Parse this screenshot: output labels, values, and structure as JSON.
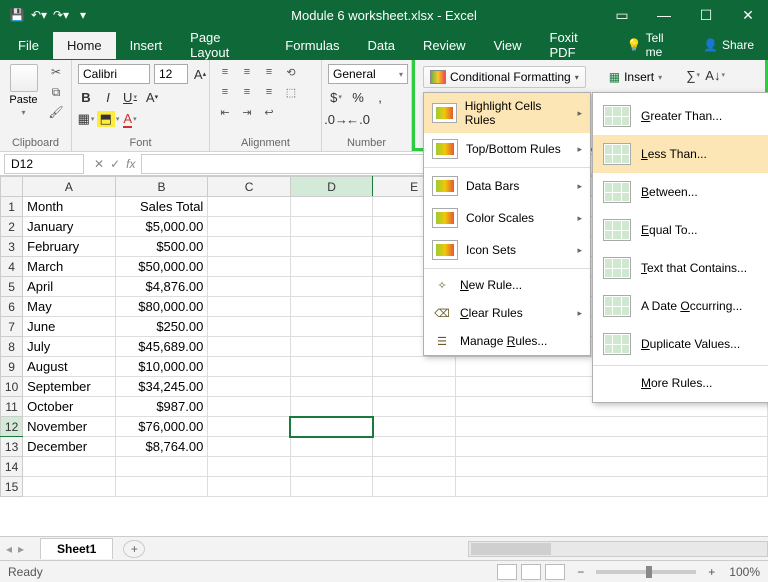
{
  "title": "Module 6 worksheet.xlsx  -  Excel",
  "qat": [
    "save-icon",
    "undo-icon",
    "redo-icon"
  ],
  "window_buttons": {
    "ribbon_opts": "▭",
    "min": "—",
    "max": "☐",
    "close": "✕"
  },
  "tabs": {
    "file": "File",
    "home": "Home",
    "insert": "Insert",
    "page_layout": "Page Layout",
    "formulas": "Formulas",
    "data": "Data",
    "review": "Review",
    "view": "View",
    "foxit": "Foxit PDF",
    "tellme": "Tell me",
    "share": "Share"
  },
  "ribbon": {
    "clipboard": {
      "paste": "Paste",
      "label": "Clipboard"
    },
    "font": {
      "name": "Calibri",
      "size": "12",
      "label": "Font"
    },
    "alignment": {
      "label": "Alignment"
    },
    "number": {
      "format": "General",
      "label": "Number"
    },
    "cf_label": "Conditional Formatting",
    "insert_label": "Insert"
  },
  "namebox": "D12",
  "columns": [
    "A",
    "B",
    "C",
    "D",
    "E"
  ],
  "rows": [
    {
      "n": "1",
      "a": "Month",
      "b": "Sales Total"
    },
    {
      "n": "2",
      "a": "January",
      "b": "$5,000.00"
    },
    {
      "n": "3",
      "a": "February",
      "b": "$500.00"
    },
    {
      "n": "4",
      "a": "March",
      "b": "$50,000.00"
    },
    {
      "n": "5",
      "a": "April",
      "b": "$4,876.00"
    },
    {
      "n": "6",
      "a": "May",
      "b": "$80,000.00"
    },
    {
      "n": "7",
      "a": "June",
      "b": "$250.00"
    },
    {
      "n": "8",
      "a": "July",
      "b": "$45,689.00"
    },
    {
      "n": "9",
      "a": "August",
      "b": "$10,000.00"
    },
    {
      "n": "10",
      "a": "September",
      "b": "$34,245.00"
    },
    {
      "n": "11",
      "a": "October",
      "b": "$987.00"
    },
    {
      "n": "12",
      "a": "November",
      "b": "$76,000.00"
    },
    {
      "n": "13",
      "a": "December",
      "b": "$8,764.00"
    },
    {
      "n": "14",
      "a": "",
      "b": ""
    },
    {
      "n": "15",
      "a": "",
      "b": ""
    }
  ],
  "cf_menu": {
    "highlight": "Highlight Cells Rules",
    "topbottom": "Top/Bottom Rules",
    "databars": "Data Bars",
    "colorscales": "Color Scales",
    "iconsets": "Icon Sets",
    "newrule": "New Rule...",
    "clear": "Clear Rules",
    "manage": "Manage Rules..."
  },
  "sub_menu": {
    "greater": "Greater Than...",
    "less": "Less Than...",
    "between": "Between...",
    "equal": "Equal To...",
    "text": "Text that Contains...",
    "date": "A Date Occurring...",
    "dup": "Duplicate Values...",
    "more": "More Rules..."
  },
  "sheet_tab": "Sheet1",
  "status": "Ready",
  "zoom": "100%"
}
